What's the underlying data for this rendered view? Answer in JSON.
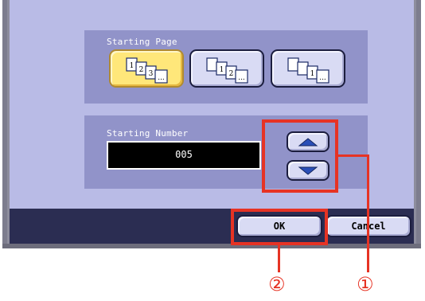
{
  "screen": {
    "starting_page": {
      "title": "Starting Page",
      "options": [
        {
          "pages": [
            "1",
            "2",
            "3",
            "..."
          ],
          "selected": true
        },
        {
          "pages": [
            "",
            "1",
            "2",
            "..."
          ],
          "selected": false
        },
        {
          "pages": [
            "",
            "",
            "1",
            "..."
          ],
          "selected": false
        }
      ]
    },
    "starting_number": {
      "title": "Starting Number",
      "value": "005",
      "up_icon": "triangle-up-icon",
      "down_icon": "triangle-down-icon"
    },
    "buttons": {
      "ok_label": "OK",
      "cancel_label": "Cancel"
    }
  },
  "callouts": {
    "arrows_number": "①",
    "ok_number": "②",
    "color": "#e63324"
  },
  "colors": {
    "panel": "#b9bbe6",
    "group": "#9193c9",
    "bottom_bar": "#2b2d52",
    "selected_button": "#ffe77a"
  }
}
